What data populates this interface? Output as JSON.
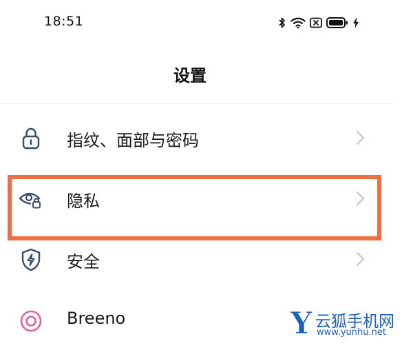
{
  "status_bar": {
    "time": "18:51",
    "icons": [
      "bluetooth-icon",
      "wifi-icon",
      "sim-off-icon",
      "battery-icon",
      "charging-icon"
    ]
  },
  "header": {
    "title": "设置"
  },
  "settings": {
    "items": [
      {
        "label": "指纹、面部与密码",
        "icon": "lock-icon"
      },
      {
        "label": "隐私",
        "icon": "privacy-eye-icon"
      },
      {
        "label": "安全",
        "icon": "shield-icon"
      },
      {
        "label": "Breeno",
        "icon": "breeno-icon"
      }
    ]
  },
  "highlight": {
    "target": "隐私",
    "color": "#ef6f43"
  },
  "watermark": {
    "logo": "Y",
    "name": "云狐手机网",
    "url": "www.yunhu.net"
  },
  "colors": {
    "icon_blue": "#3b4a6b",
    "chevron": "#c4c4c4",
    "breeno_pink": "#e0629a",
    "watermark_blue": "#1d5fbd"
  }
}
